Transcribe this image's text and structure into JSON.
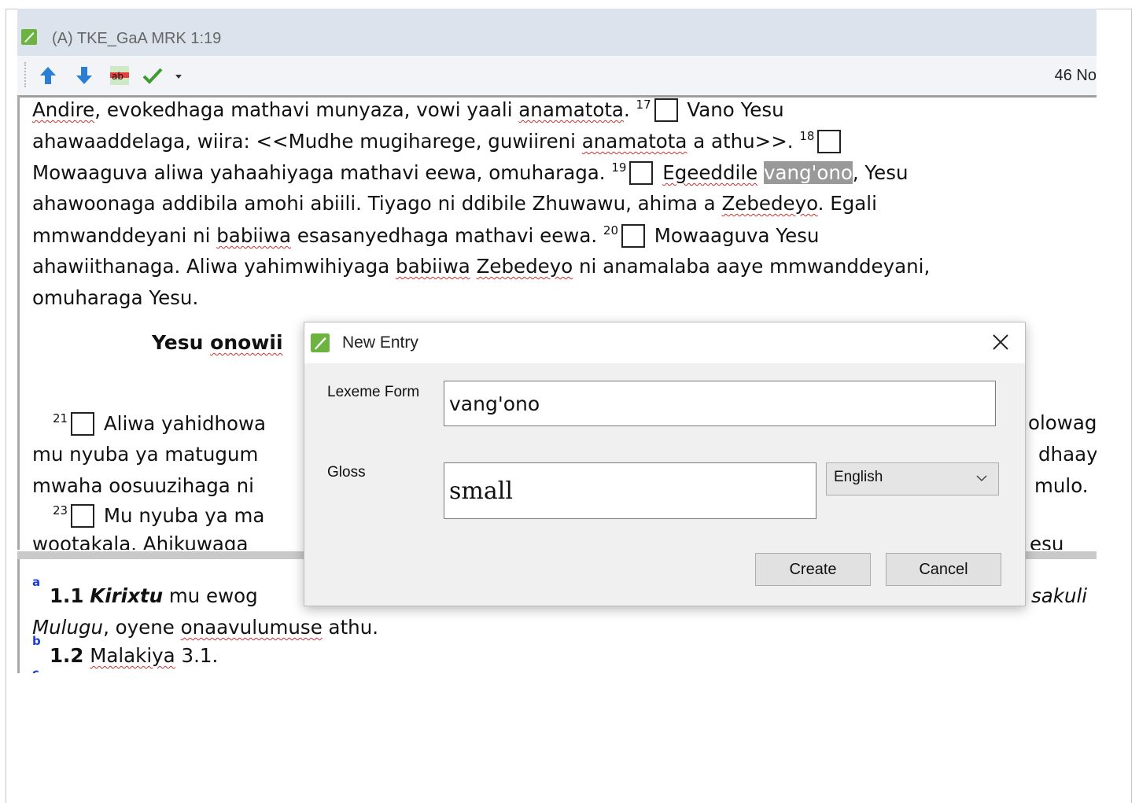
{
  "window": {
    "title": "(A) TKE_GaA MRK 1:19",
    "status_right": "46 No"
  },
  "toolbar": {
    "icons": [
      "arrow-up-icon",
      "arrow-down-icon",
      "spelling-icon",
      "checkmark-icon",
      "dropdown-arrow-icon"
    ]
  },
  "text": {
    "l1": {
      "a": "Andire",
      "b": ", evokedhaga mathavi munyaza, vowi yaali ",
      "c": "anamatota",
      "d": ". ",
      "v": "17",
      "e": " Vano Yesu"
    },
    "l2": {
      "a": "ahawaaddelaga, wiira: <<Mudhe mugiharege, guwiireni ",
      "b": "anamatota",
      "c": " a athu>>. ",
      "v": "18"
    },
    "l3": {
      "a": "Mowaaguva aliwa yahaahiyaga mathavi eewa, omuharaga. ",
      "v": "19",
      "b": "Egeeddile",
      "c": "vang'ono",
      "d": ", Yesu"
    },
    "l4": {
      "a": "ahawoonaga addibila amohi abiili. Tiyago ni ddibile Zhuwawu, ahima a ",
      "b": "Zebedeyo",
      "c": ". Egali"
    },
    "l5": {
      "a": "mmwanddeyani ni ",
      "b": "babiiwa",
      "c": " esasanyedhaga mathavi eewa. ",
      "v": "20",
      "d": " Mowaaguva Yesu"
    },
    "l6": {
      "a": "ahawiithanaga. Aliwa yahimwihiyaga ",
      "b": "babiiwa",
      "c": " ",
      "d": "Zebedeyo",
      "e": " ni anamalaba aaye mmwanddeyani,"
    },
    "l7": "omuharaga Yesu.",
    "heading": {
      "a": "Yesu ",
      "b": "onowii"
    },
    "l8": {
      "v": "21",
      "a": "Aliwa yahidhowa",
      "r": "olowag"
    },
    "l9": {
      "a": "mu nyuba ya matugum",
      "r": "dhaay"
    },
    "l10": {
      "a": "mwaha oosuuzihaga ni",
      "r": "mulo."
    },
    "l11": {
      "v": "23",
      "a": "Mu nyuba ya ma"
    },
    "l12": {
      "a": "wootakala. Ahikuwaga",
      "r": "esu"
    }
  },
  "notes": {
    "m1": "a",
    "n1": {
      "num": "1.1",
      "term": "Kirixtu",
      "a": " mu ewog",
      "r": "sakuli"
    },
    "n1b": {
      "a": "Mulugu",
      "b": ", oyene ",
      "c": "onaavulumuse",
      "d": " athu."
    },
    "m2": "b",
    "n2": {
      "num": "1.2",
      "a": "Malakiya",
      "b": " 3.1."
    },
    "m3": "c"
  },
  "dialog": {
    "title": "New Entry",
    "lexeme_label": "Lexeme Form",
    "lexeme_value": "vang'ono",
    "gloss_label": "Gloss",
    "gloss_value": "small",
    "language": "English",
    "create_label": "Create",
    "cancel_label": "Cancel"
  }
}
